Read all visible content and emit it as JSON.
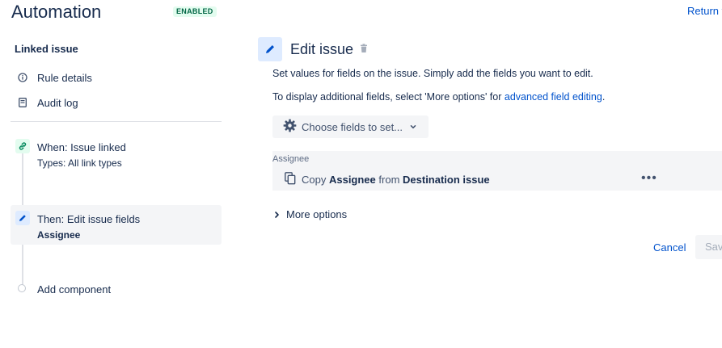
{
  "header": {
    "title": "Automation",
    "status_badge": "ENABLED",
    "return_link": "Return t"
  },
  "sidebar": {
    "heading": "Linked issue",
    "items": [
      {
        "label": "Rule details",
        "icon": "info-icon"
      },
      {
        "label": "Audit log",
        "icon": "document-icon"
      }
    ],
    "steps": {
      "when": {
        "title": "When: Issue linked",
        "detail": "Types: All link types",
        "icon": "link-icon"
      },
      "then": {
        "title": "Then: Edit issue fields",
        "detail": "Assignee",
        "icon": "pencil-icon"
      },
      "add": {
        "label": "Add component"
      }
    }
  },
  "main": {
    "title": "Edit issue",
    "description": "Set values for fields on the issue. Simply add the fields you want to edit.",
    "additional_prefix": "To display additional fields, select 'More options' for ",
    "additional_link": "advanced field editing",
    "additional_suffix": ".",
    "choose_fields_label": "Choose fields to set...",
    "field": {
      "label": "Assignee",
      "prefix": "Copy ",
      "field_name": "Assignee",
      "middle": " from ",
      "source": "Destination issue",
      "more_icon": "ellipsis-icon"
    },
    "more_options_label": "More options",
    "cancel_label": "Cancel",
    "save_label": "Save"
  },
  "colors": {
    "link": "#0052cc",
    "enabled_text": "#006644",
    "enabled_bg": "#e3fcef",
    "accent_bg": "#deebff",
    "panel_bg": "#f4f5f7"
  }
}
